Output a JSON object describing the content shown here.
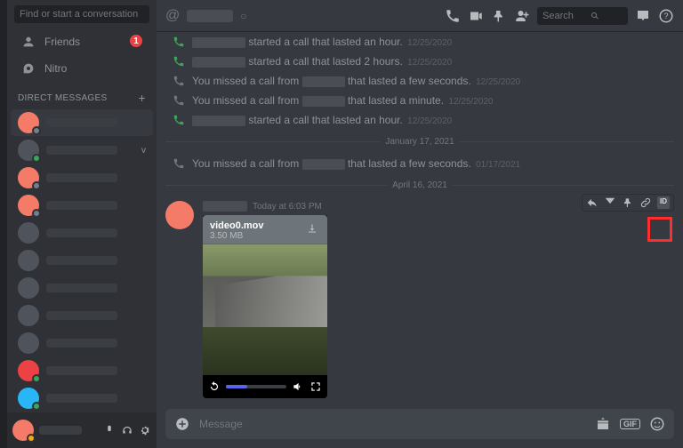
{
  "sidebar": {
    "search_placeholder": "Find or start a conversation",
    "friends_label": "Friends",
    "friends_badge": "1",
    "nitro_label": "Nitro",
    "dm_header": "DIRECT MESSAGES"
  },
  "header": {
    "search_placeholder": "Search"
  },
  "calls": [
    {
      "kind": "green",
      "text_suffix": "started a call that lasted an hour.",
      "date": "12/25/2020"
    },
    {
      "kind": "green",
      "text_suffix": "started a call that lasted 2 hours.",
      "date": "12/25/2020"
    },
    {
      "kind": "grey",
      "text_prefix": "You missed a call from",
      "text_suffix": "that lasted a few seconds.",
      "date": "12/25/2020"
    },
    {
      "kind": "grey",
      "text_prefix": "You missed a call from",
      "text_suffix": "that lasted a minute.",
      "date": "12/25/2020"
    },
    {
      "kind": "green",
      "text_suffix": "started a call that lasted an hour.",
      "date": "12/25/2020"
    }
  ],
  "divider1": "January 17, 2021",
  "missed_after_div": {
    "text_prefix": "You missed a call from",
    "text_suffix": "that lasted a few seconds.",
    "date": "01/17/2021"
  },
  "divider2": "April 16, 2021",
  "message": {
    "time": "Today at 6:03 PM",
    "id_chip": "ID",
    "attachment": {
      "filename": "video0.mov",
      "size": "3.50 MB"
    }
  },
  "chatbar": {
    "placeholder": "Message",
    "gif_label": "GIF"
  }
}
